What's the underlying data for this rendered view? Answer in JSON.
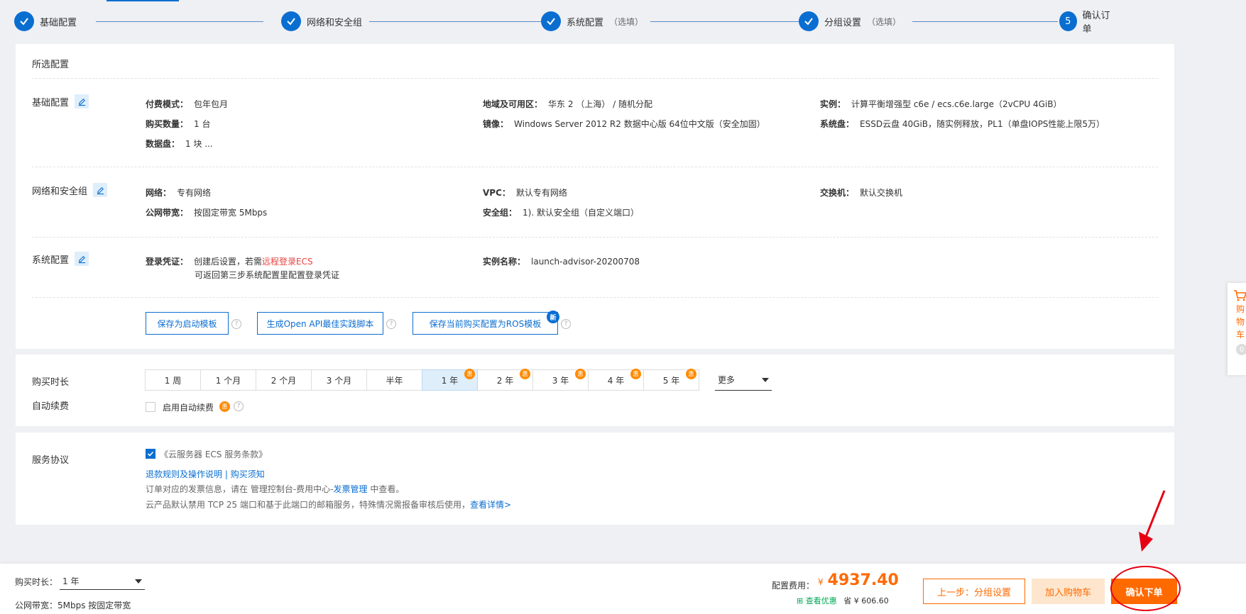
{
  "steps": [
    {
      "label": "基础配置",
      "optional": "",
      "done": true
    },
    {
      "label": "网络和安全组",
      "optional": "",
      "done": true
    },
    {
      "label": "系统配置",
      "optional": "（选填）",
      "done": true
    },
    {
      "label": "分组设置",
      "optional": "（选填）",
      "done": true
    },
    {
      "label": "确认订单",
      "optional": "",
      "num": "5",
      "done": false
    }
  ],
  "selected": {
    "title": "所选配置",
    "basic": {
      "title": "基础配置",
      "pay_mode_k": "付费模式：",
      "pay_mode_v": "包年包月",
      "qty_k": "购买数量：",
      "qty_v": "1 台",
      "disk_k": "数据盘：",
      "disk_v": "1 块 ...",
      "region_k": "地域及可用区：",
      "region_v": "华东 2 （上海） / 随机分配",
      "image_k": "镜像：",
      "image_v": "Windows Server 2012 R2 数据中心版 64位中文版（安全加固）",
      "instance_k": "实例：",
      "instance_v": "计算平衡增强型 c6e / ecs.c6e.large（2vCPU 4GiB）",
      "sysdisk_k": "系统盘：",
      "sysdisk_v": "ESSD云盘 40GiB，随实例释放，PL1（单盘IOPS性能上限5万）"
    },
    "network": {
      "title": "网络和安全组",
      "net_k": "网络：",
      "net_v": "专有网络",
      "bw_k": "公网带宽：",
      "bw_v": "按固定带宽 5Mbps",
      "vpc_k": "VPC：",
      "vpc_v": "默认专有网络",
      "sg_k": "安全组：",
      "sg_v": "1). 默认安全组（自定义端口）",
      "switch_k": "交换机：",
      "switch_v": "默认交换机"
    },
    "system": {
      "title": "系统配置",
      "cred_k": "登录凭证：",
      "cred_v1": "创建后设置，若需",
      "cred_v1_red": "远程登录ECS",
      "cred_v2": "可返回第三步系统配置里配置登录凭证",
      "name_k": "实例名称：",
      "name_v": "launch-advisor-20200708"
    },
    "buttons": {
      "save_template": "保存为启动模板",
      "gen_api": "生成Open API最佳实践脚本",
      "save_ros": "保存当前购买配置为ROS模板",
      "new_badge": "新"
    }
  },
  "purchase": {
    "duration_label": "购买时长",
    "durations": [
      {
        "label": "1 周",
        "discount": false
      },
      {
        "label": "1 个月",
        "discount": false
      },
      {
        "label": "2 个月",
        "discount": false
      },
      {
        "label": "3 个月",
        "discount": false
      },
      {
        "label": "半年",
        "discount": false
      },
      {
        "label": "1 年",
        "discount": true,
        "active": true
      },
      {
        "label": "2 年",
        "discount": true
      },
      {
        "label": "3 年",
        "discount": true
      },
      {
        "label": "4 年",
        "discount": true
      },
      {
        "label": "5 年",
        "discount": true
      }
    ],
    "discount_glyph": "惠",
    "more": "更多",
    "auto_renew_label": "自动续费",
    "auto_renew_text": "启用自动续费"
  },
  "agreement": {
    "label": "服务协议",
    "terms": "《云服务器 ECS 服务条款》",
    "refund": "退款规则及操作说明",
    "sep": "|",
    "notice": "购买须知",
    "invoice_pre": "订单对应的发票信息，请在 管理控制台-费用中心-",
    "invoice_link": "发票管理",
    "invoice_post": " 中查看。",
    "port_text": "云产品默认禁用 TCP 25 端口和基于此端口的邮箱服务，特殊情况需报备审核后使用，",
    "port_link": "查看详情>"
  },
  "cart_float": {
    "text": "购物车",
    "count": "0"
  },
  "bottom": {
    "duration_label": "购买时长：",
    "duration_value": "1 年",
    "bandwidth_label": "公网带宽：",
    "bandwidth_value": "5Mbps 按固定带宽",
    "price_label": "配置费用：",
    "currency": "¥",
    "price": "4937.40",
    "discount_view": "查看优惠",
    "save_label": "省 ¥ 606.60",
    "prev_btn": "上一步：分组设置",
    "add_cart_btn": "加入购物车",
    "confirm_btn": "确认下单"
  },
  "colors": {
    "primary": "#0a6ed1",
    "orange": "#ff6a00",
    "annotation": "#e60012"
  }
}
